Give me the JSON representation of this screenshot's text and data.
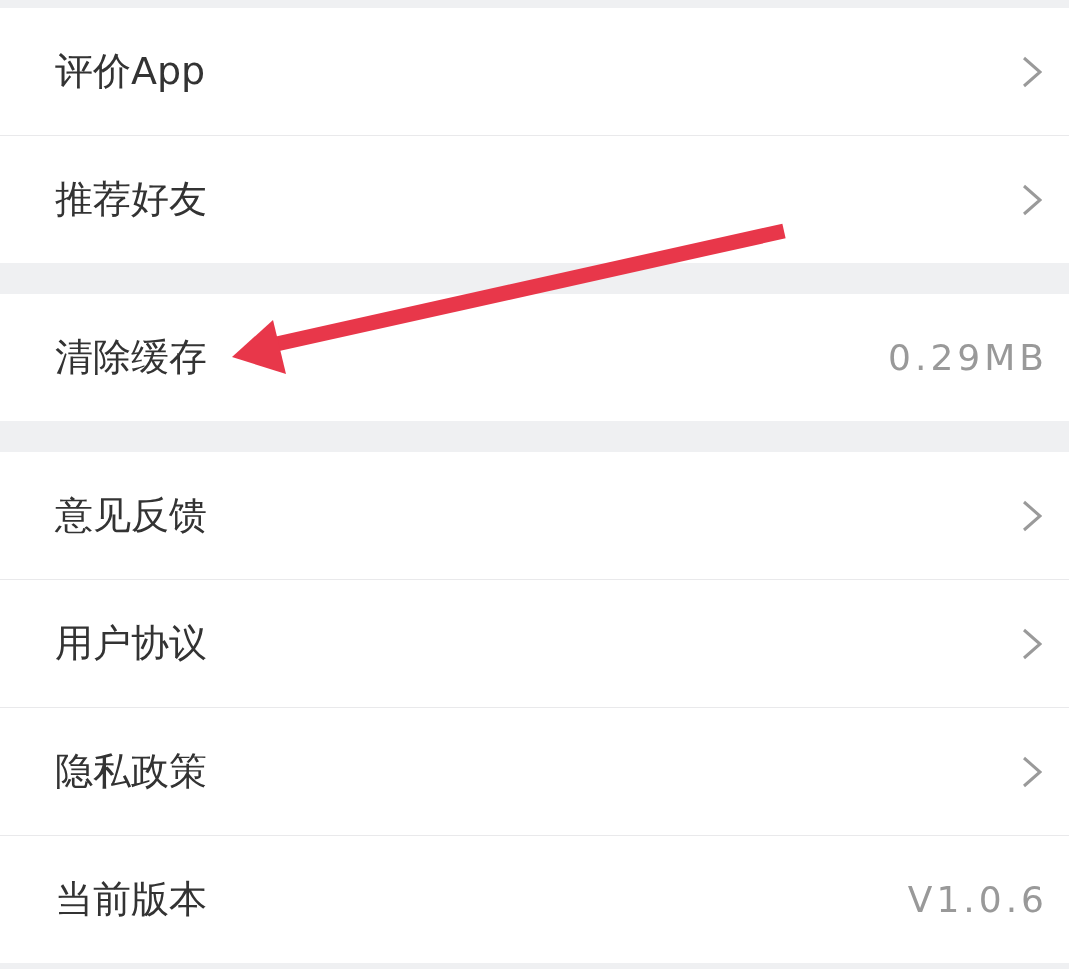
{
  "sections": [
    {
      "items": [
        {
          "label": "评价App",
          "kind": "link"
        },
        {
          "label": "推荐好友",
          "kind": "link"
        }
      ]
    },
    {
      "items": [
        {
          "label": "清除缓存",
          "kind": "value",
          "value": "0.29MB"
        }
      ]
    },
    {
      "items": [
        {
          "label": "意见反馈",
          "kind": "link"
        },
        {
          "label": "用户协议",
          "kind": "link"
        },
        {
          "label": "隐私政策",
          "kind": "link"
        },
        {
          "label": "当前版本",
          "kind": "value",
          "value": "V1.0.6"
        }
      ]
    }
  ],
  "annotations": [
    {
      "kind": "arrow"
    }
  ]
}
